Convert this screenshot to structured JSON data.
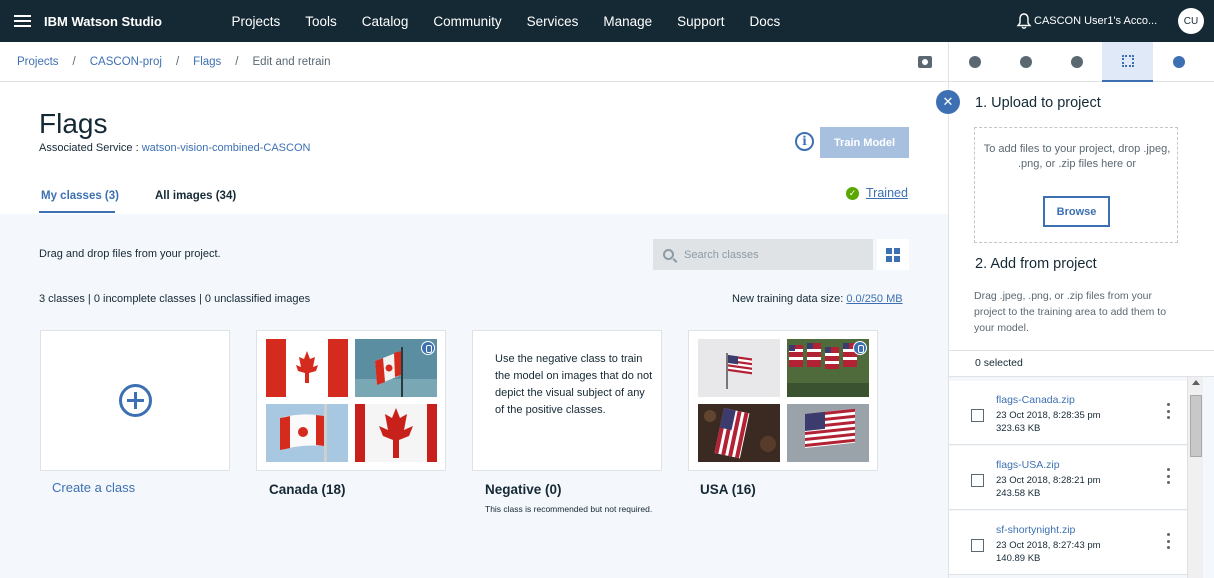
{
  "header": {
    "brand_bold": "IBM",
    "brand_rest": "Watson Studio",
    "nav": [
      "Projects",
      "Tools",
      "Catalog",
      "Community",
      "Services",
      "Manage",
      "Support",
      "Docs"
    ],
    "account": "CASCON User1's Acco...",
    "avatar_initials": "CU"
  },
  "breadcrumb": {
    "items": [
      "Projects",
      "CASCON-proj",
      "Flags",
      "Edit and retrain"
    ],
    "separator": "/"
  },
  "page": {
    "title": "Flags",
    "assoc_label": "Associated Service : ",
    "assoc_link": "watson-vision-combined-CASCON",
    "train_button": "Train Model",
    "info_glyph": "i",
    "tabs": [
      "My classes (3)",
      "All images (34)"
    ],
    "status": "Trained",
    "drag_text": "Drag and drop files from your project.",
    "search_placeholder": "Search classes",
    "counts": "3 classes | 0 incomplete classes | 0 unclassified images",
    "datasize_label": "New training data size: ",
    "datasize_value": "0.0/250 MB"
  },
  "classes": {
    "create_label": "Create a class",
    "canada": "Canada (18)",
    "negative": "Negative (0)",
    "negative_desc": "Use the negative class to train the model on images that do not depict the visual subject of any of the positive classes.",
    "negative_note": "This class is recommended but not required.",
    "usa": "USA (16)"
  },
  "panel": {
    "close_glyph": "✕",
    "upload_heading": "1. Upload to project",
    "drop_text": "To add files to your project, drop .jpeg, .png, or .zip files here or",
    "browse": "Browse",
    "add_heading": "2. Add from project",
    "add_text": "Drag .jpeg, .png, or .zip files from your project to the training area to add them to your model.",
    "selected": "0 selected",
    "files": [
      {
        "name": "flags-Canada.zip",
        "date": "23 Oct 2018, 8:28:35 pm",
        "size": "323.63 KB"
      },
      {
        "name": "flags-USA.zip",
        "date": "23 Oct 2018, 8:28:21 pm",
        "size": "243.58 KB"
      },
      {
        "name": "sf-shortynight.zip",
        "date": "23 Oct 2018, 8:27:43 pm",
        "size": "140.89 KB"
      }
    ]
  },
  "colors": {
    "header_bg": "#152935",
    "accent": "#3d70b2",
    "trained_green": "#5aa700",
    "canada_red": "#d52b1e",
    "usa_red": "#b22234",
    "usa_blue": "#3c3b6e"
  }
}
